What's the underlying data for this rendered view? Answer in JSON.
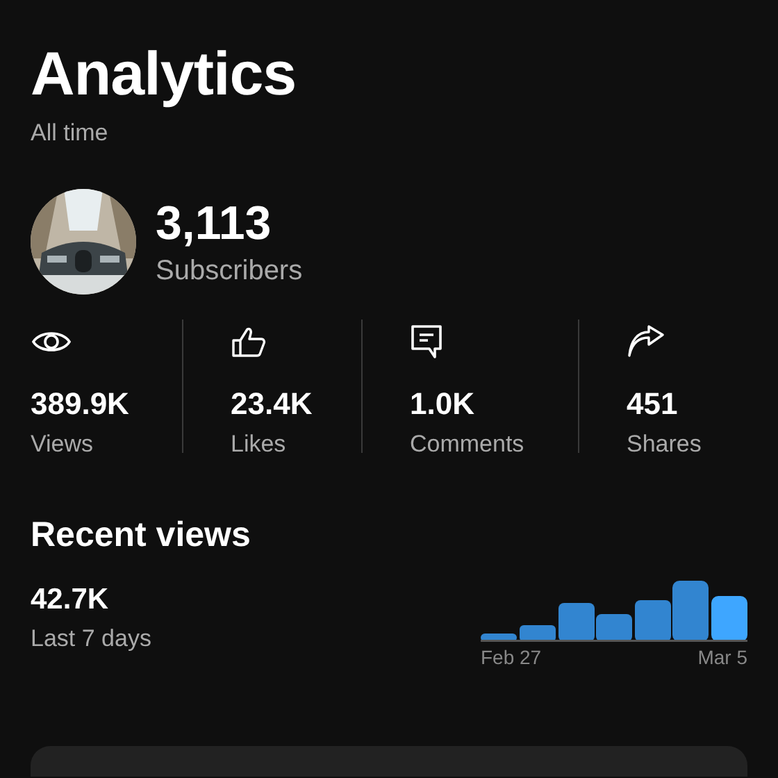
{
  "header": {
    "title": "Analytics",
    "period": "All time"
  },
  "channel": {
    "subscriber_count": "3,113",
    "subscriber_label": "Subscribers"
  },
  "stats": [
    {
      "kind": "views",
      "value": "389.9K",
      "label": "Views"
    },
    {
      "kind": "likes",
      "value": "23.4K",
      "label": "Likes"
    },
    {
      "kind": "comments",
      "value": "1.0K",
      "label": "Comments"
    },
    {
      "kind": "shares",
      "value": "451",
      "label": "Shares"
    }
  ],
  "recent_views": {
    "title": "Recent views",
    "value": "42.7K",
    "period": "Last 7 days",
    "start_label": "Feb 27",
    "end_label": "Mar 5"
  }
}
